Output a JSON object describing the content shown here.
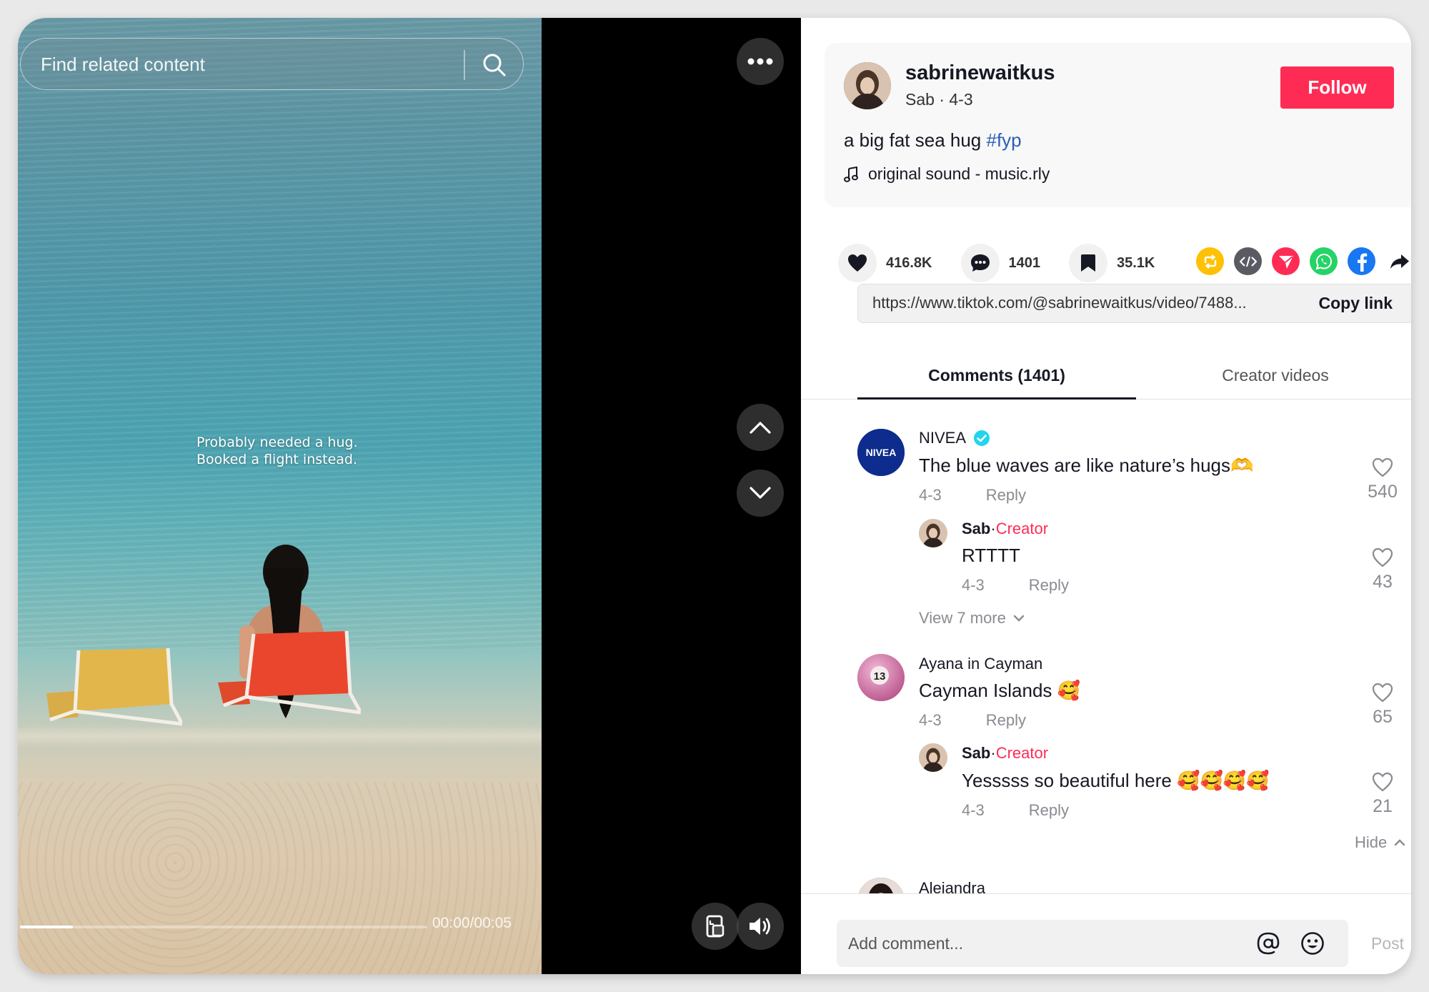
{
  "search": {
    "placeholder": "Find related content"
  },
  "video": {
    "caption_line1": "Probably needed a hug.",
    "caption_line2": "Booked a flight instead.",
    "timecode": "00:00/00:05",
    "progress": 0.13
  },
  "author": {
    "username": "sabrinewaitkus",
    "subtitle": "Sab · 4-3",
    "follow_label": "Follow",
    "description": "a big fat sea hug ",
    "hashtag": "#fyp",
    "sound": "original sound - music.rly"
  },
  "stats": {
    "likes": "416.8K",
    "comments": "1401",
    "saves": "35.1K"
  },
  "share_icons": [
    "repost-icon",
    "embed-icon",
    "send-icon",
    "whatsapp-icon",
    "facebook-icon",
    "share-arrow-icon"
  ],
  "link": {
    "url": "https://www.tiktok.com/@sabrinewaitkus/video/7488...",
    "copy_label": "Copy link"
  },
  "tabs": {
    "comments": "Comments (1401)",
    "creator_videos": "Creator videos"
  },
  "comments": [
    {
      "user": "NIVEA",
      "avatar_text": "NIVEA",
      "verified": true,
      "text": "The blue waves are like nature’s hugs🫶",
      "date": "4-3",
      "reply": "Reply",
      "likes": "540",
      "replies": [
        {
          "user": "Sab",
          "sep": " · ",
          "badge": "Creator",
          "text": "RTTTT",
          "date": "4-3",
          "reply": "Reply",
          "likes": "43"
        }
      ],
      "view_more": "View 7 more"
    },
    {
      "user": "Ayana in Cayman",
      "avatar_text": "13",
      "text": "Cayman Islands 🥰",
      "date": "4-3",
      "reply": "Reply",
      "likes": "65",
      "replies": [
        {
          "user": "Sab",
          "sep": " · ",
          "badge": "Creator",
          "text": "Yesssss so beautiful here 🥰🥰🥰🥰",
          "date": "4-3",
          "reply": "Reply",
          "likes": "21"
        }
      ],
      "hide": "Hide"
    },
    {
      "user": "Alejandra"
    }
  ],
  "footer": {
    "placeholder": "Add comment...",
    "post_label": "Post"
  },
  "colors": {
    "follow": "#fe2c55",
    "hashtag": "#2b5db9",
    "creator": "#fe2c55",
    "verified": "#20d5ec"
  }
}
